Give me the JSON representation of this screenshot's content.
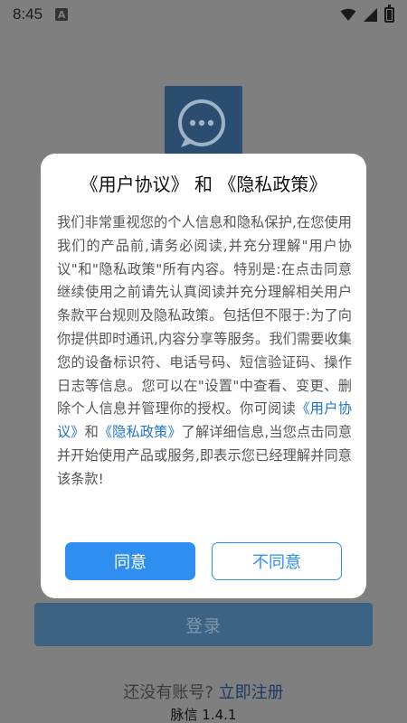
{
  "status_bar": {
    "time": "8:45",
    "notification_icon": "a-letter-icon",
    "wifi_icon": "wifi-icon",
    "signal_icon": "signal-icon",
    "battery_icon": "battery-icon"
  },
  "background": {
    "logo_icon": "chat-bubbles-icon",
    "login_label": "登录",
    "register_prompt": "还没有账号?",
    "register_link": "立即注册",
    "version": "脉信 1.4.1"
  },
  "dialog": {
    "title": "《用户协议》 和 《隐私政策》",
    "body_part1": "我们非常重视您的个人信息和隐私保护,在您使用我们的产品前,请务必阅读,并充分理解\"用户协议\"和\"隐私政策\"所有内容。特别是:在点击同意继续使用之前请先认真阅读并充分理解相关用户条款平台规则及隐私政策。包括但不限于:为了向你提供即时通讯,内容分享等服务。我们需要收集您的设备标识符、电话号码、短信验证码、操作日志等信息。您可以在\"设置\"中查看、变更、删除个人信息并管理你的授权。你可阅读",
    "link_user_agreement": "《用户协议》",
    "body_and": "和",
    "link_privacy_policy": "《隐私政策》",
    "body_part2": "了解详细信息,当您点击同意并开始使用产品或服务,即表示您已经理解并同意该条款!",
    "agree_label": "同意",
    "disagree_label": "不同意"
  },
  "colors": {
    "primary": "#2f8ff0",
    "link": "#1e73c8",
    "overlay_bg": "#7f7f7f",
    "login_button_dimmed": "#3d6384"
  }
}
